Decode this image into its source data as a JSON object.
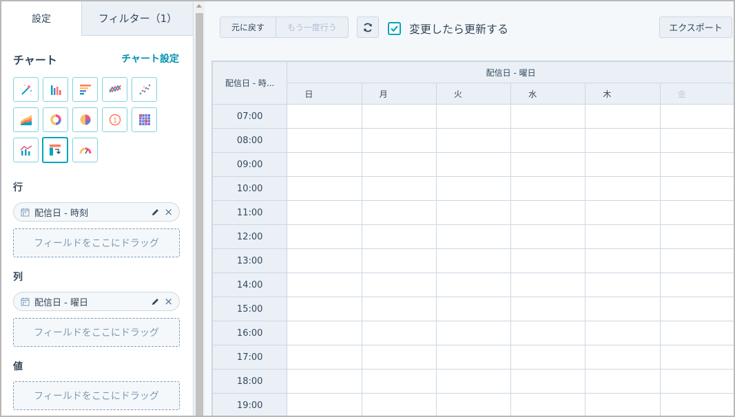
{
  "tabs": [
    {
      "label": "設定",
      "active": true
    },
    {
      "label": "フィルター（1）",
      "active": false
    }
  ],
  "chart_section": {
    "title": "チャート",
    "settings_link": "チャート設定",
    "chart_types": [
      {
        "icon": "magic-wand-icon",
        "selected": false
      },
      {
        "icon": "column-chart-icon",
        "selected": false
      },
      {
        "icon": "bar-chart-icon",
        "selected": false
      },
      {
        "icon": "line-chart-icon",
        "selected": false
      },
      {
        "icon": "scatter-chart-icon",
        "selected": false
      },
      {
        "icon": "area-chart-icon",
        "selected": false
      },
      {
        "icon": "donut-chart-icon",
        "selected": false
      },
      {
        "icon": "pie-chart-icon",
        "selected": false
      },
      {
        "icon": "kpi-icon",
        "selected": false
      },
      {
        "icon": "heatmap-icon",
        "selected": false
      },
      {
        "icon": "combo-chart-icon",
        "selected": false
      },
      {
        "icon": "pivot-table-icon",
        "selected": true
      },
      {
        "icon": "gauge-icon",
        "selected": false
      }
    ]
  },
  "rows": {
    "label": "行",
    "field": "配信日 - 時刻",
    "dropzone": "フィールドをここにドラッグ"
  },
  "columns": {
    "label": "列",
    "field": "配信日 - 曜日",
    "dropzone": "フィールドをここにドラッグ"
  },
  "values": {
    "label": "値",
    "dropzone": "フィールドをここにドラッグ"
  },
  "toolbar": {
    "undo": "元に戻す",
    "redo": "もう一度行う",
    "auto_update": "変更したら更新する",
    "auto_update_checked": true,
    "export": "エクスポート"
  },
  "table": {
    "row_header": "配信日 - 時...",
    "column_group": "配信日 - 曜日",
    "days": [
      "日",
      "月",
      "火",
      "水",
      "木",
      "金"
    ],
    "times": [
      "07:00",
      "08:00",
      "09:00",
      "10:00",
      "11:00",
      "12:00",
      "13:00",
      "14:00",
      "15:00",
      "16:00",
      "17:00",
      "18:00",
      "19:00"
    ]
  },
  "colors": {
    "accent": "#00a4bd",
    "link": "#0091ae",
    "header_bg": "#eaf0f6",
    "border": "#cbd6e2"
  }
}
